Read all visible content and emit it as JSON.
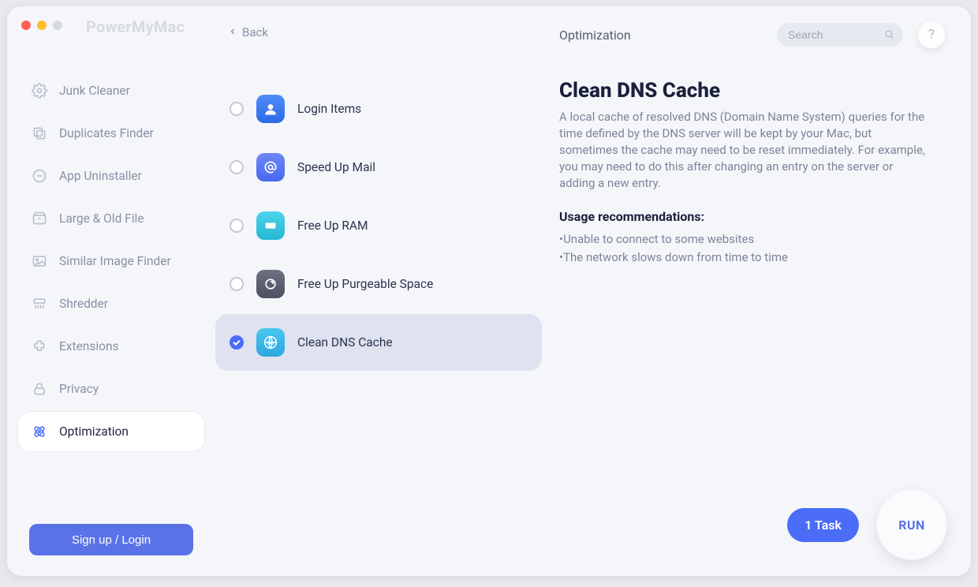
{
  "app_title": "PowerMyMac",
  "back_label": "Back",
  "sidebar": {
    "items": [
      {
        "label": "Junk Cleaner"
      },
      {
        "label": "Duplicates Finder"
      },
      {
        "label": "App Uninstaller"
      },
      {
        "label": "Large & Old File"
      },
      {
        "label": "Similar Image Finder"
      },
      {
        "label": "Shredder"
      },
      {
        "label": "Extensions"
      },
      {
        "label": "Privacy"
      },
      {
        "label": "Optimization"
      }
    ],
    "signup_label": "Sign up / Login"
  },
  "middle": {
    "options": [
      {
        "label": "Login Items",
        "icon": "login-items-icon",
        "icon_bg": "linear-gradient(180deg,#4f8df9,#2e6ae6)",
        "checked": false
      },
      {
        "label": "Speed Up Mail",
        "icon": "mail-at-icon",
        "icon_bg": "linear-gradient(180deg,#6d86f5,#4a68ee)",
        "checked": false
      },
      {
        "label": "Free Up RAM",
        "icon": "ram-chip-icon",
        "icon_bg": "linear-gradient(180deg,#4cd3e9,#27b7d6)",
        "checked": false
      },
      {
        "label": "Free Up Purgeable Space",
        "icon": "purgeable-icon",
        "icon_bg": "linear-gradient(180deg,#6c7080,#4c5060)",
        "checked": false
      },
      {
        "label": "Clean DNS Cache",
        "icon": "dns-globe-icon",
        "icon_bg": "linear-gradient(180deg,#4bc6ef,#2ea7e0)",
        "checked": true
      }
    ]
  },
  "right": {
    "section_title": "Optimization",
    "search_placeholder": "Search",
    "help_label": "?",
    "detail_title": "Clean DNS Cache",
    "detail_desc": "A local cache of resolved DNS (Domain Name System) queries for the time defined by the DNS server will be kept by your Mac, but sometimes the cache may need to be reset immediately. For example, you may need to do this after changing an entry on the server or adding a new entry.",
    "usage_heading": "Usage recommendations:",
    "recommendations": [
      "Unable to connect to some websites",
      "The network slows down from time to time"
    ],
    "task_label": "1 Task",
    "run_label": "RUN"
  }
}
